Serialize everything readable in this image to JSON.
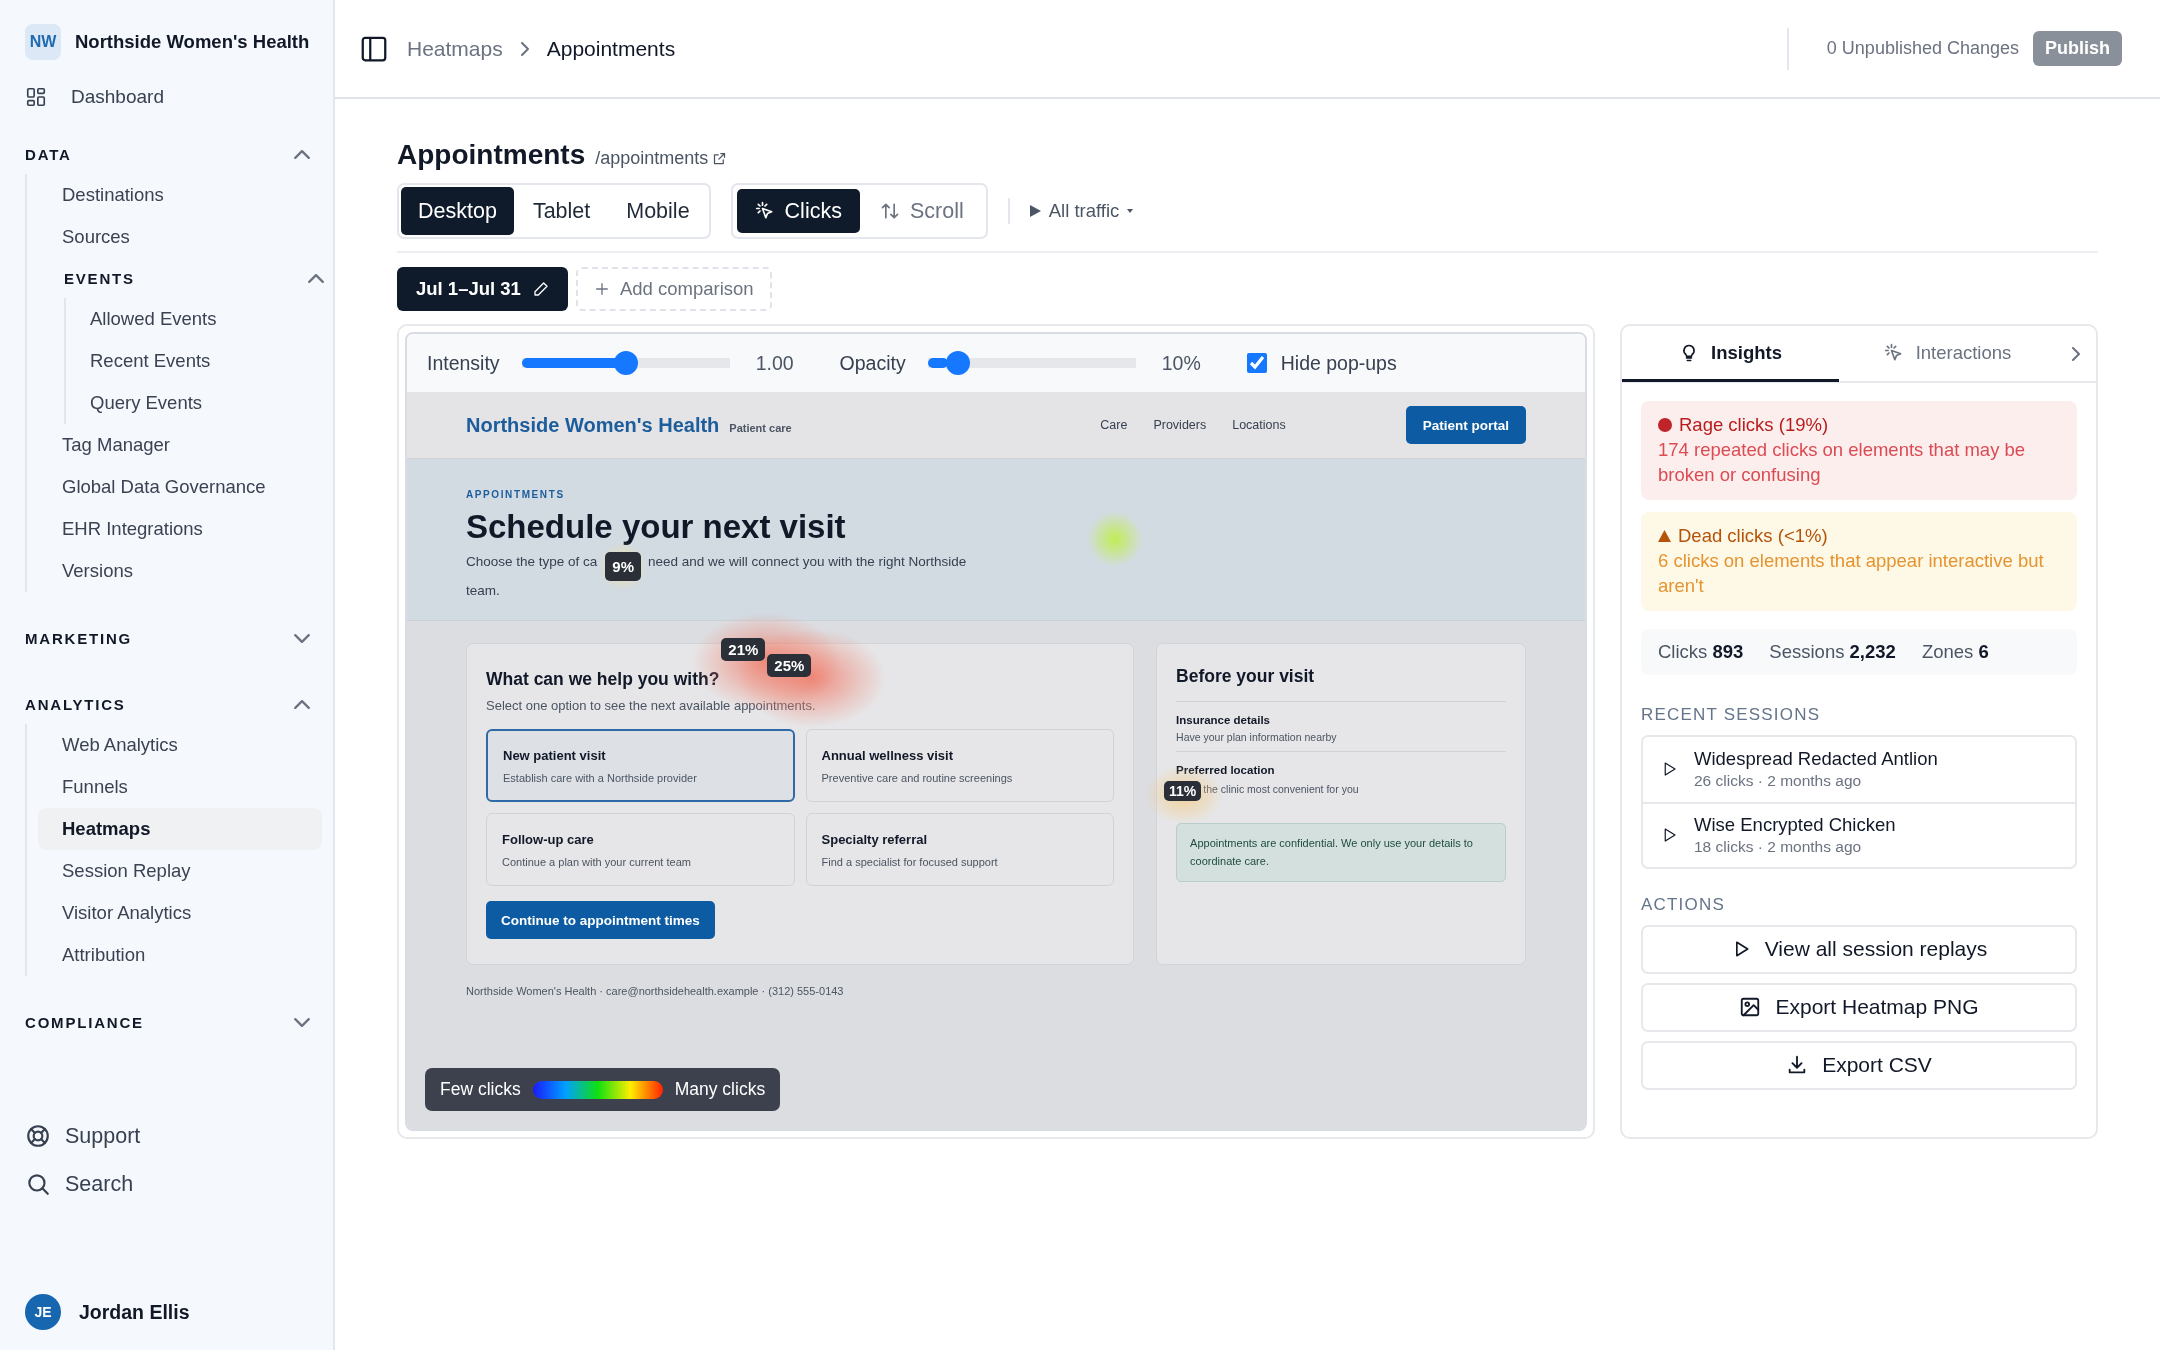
{
  "sidebar": {
    "org": {
      "initials": "NW",
      "name": "Northside Women's Health"
    },
    "dashboard": "Dashboard",
    "sections": [
      {
        "label": "DATA",
        "expanded": true,
        "items": [
          {
            "label": "Destinations",
            "selected": false
          },
          {
            "label": "Sources",
            "selected": false
          },
          {
            "kind": "group",
            "label": "EVENTS",
            "expanded": true,
            "children": [
              {
                "label": "Allowed Events",
                "selected": false
              },
              {
                "label": "Recent Events",
                "selected": false
              },
              {
                "label": "Query Events",
                "selected": false
              }
            ]
          },
          {
            "label": "Tag Manager",
            "selected": false
          },
          {
            "label": "Global Data Governance",
            "selected": false
          },
          {
            "label": "EHR Integrations",
            "selected": false
          },
          {
            "label": "Versions",
            "selected": false
          }
        ]
      },
      {
        "label": "MARKETING",
        "expanded": false
      },
      {
        "label": "ANALYTICS",
        "expanded": true,
        "items": [
          {
            "label": "Web Analytics",
            "selected": false
          },
          {
            "label": "Funnels",
            "selected": false
          },
          {
            "label": "Heatmaps",
            "selected": true
          },
          {
            "label": "Session Replay",
            "selected": false
          },
          {
            "label": "Visitor Analytics",
            "selected": false
          },
          {
            "label": "Attribution",
            "selected": false
          }
        ]
      },
      {
        "label": "COMPLIANCE",
        "expanded": false
      }
    ],
    "footer_links": [
      {
        "kind": "support",
        "label": "Support"
      },
      {
        "kind": "search",
        "label": "Search"
      }
    ],
    "user": {
      "initials": "JE",
      "name": "Jordan Ellis"
    }
  },
  "header": {
    "breadcrumb": [
      "Heatmaps",
      "Appointments"
    ],
    "unpublished": "0 Unpublished Changes",
    "publish": {
      "label": "Publish",
      "disabled": true
    }
  },
  "page": {
    "title": "Appointments",
    "path": "/appointments",
    "devices": [
      {
        "label": "Desktop",
        "selected": true
      },
      {
        "label": "Tablet",
        "selected": false
      },
      {
        "label": "Mobile",
        "selected": false
      }
    ],
    "modes": [
      {
        "kind": "clicks",
        "label": "Clicks",
        "selected": true
      },
      {
        "kind": "scroll",
        "label": "Scroll",
        "selected": false
      }
    ],
    "traffic": "All traffic",
    "date_range": "Jul 1–Jul 31",
    "add_comparison": "Add comparison"
  },
  "controls": {
    "intensity": {
      "label": "Intensity",
      "level": 0.5,
      "reading": "1.00"
    },
    "opacity": {
      "label": "Opacity",
      "level": 0.1,
      "reading": "10%"
    },
    "hide_popups": {
      "label": "Hide pop-ups",
      "checked": true
    }
  },
  "preview": {
    "site_name": "Northside Women's Health",
    "site_tag": "Patient care",
    "nav": [
      "Care",
      "Providers",
      "Locations"
    ],
    "portal": "Patient portal",
    "eyebrow": "APPOINTMENTS",
    "headline": "Schedule your next visit",
    "intro_before": "Choose the type of ca",
    "intro_badge": "9%",
    "intro_after": "need and we will connect you with the right Northside",
    "intro_end": "team.",
    "help": {
      "title": "What can we help you with?",
      "badges": [
        "21%",
        "25%"
      ],
      "subtitle": "Select one option to see the next available appointments.",
      "options": [
        {
          "title": "New patient visit",
          "desc": "Establish care with a Northside provider",
          "selected": true
        },
        {
          "title": "Annual wellness visit",
          "desc": "Preventive care and routine screenings",
          "selected": false
        },
        {
          "title": "Follow-up care",
          "desc": "Continue a plan with your current team",
          "selected": false
        },
        {
          "title": "Specialty referral",
          "desc": "Find a specialist for focused support",
          "selected": false
        }
      ],
      "cta": "Continue to appointment times"
    },
    "before": {
      "title": "Before your visit",
      "items": [
        {
          "title": "Insurance details",
          "desc": "Have your plan information nearby"
        },
        {
          "title": "Preferred location",
          "badge": "11%",
          "desc": "the clinic most convenient for you"
        }
      ],
      "note": "Appointments are confidential. We only use your details to coordinate care."
    },
    "footer": "Northside Women's Health · care@northsidehealth.example · (312) 555-0143",
    "legend": {
      "low": "Few clicks",
      "high": "Many clicks"
    }
  },
  "insights": {
    "tabs": [
      {
        "kind": "insights",
        "label": "Insights",
        "selected": true
      },
      {
        "kind": "interactions",
        "label": "Interactions",
        "selected": false
      }
    ],
    "alerts": [
      {
        "kind": "rage",
        "title": "Rage clicks (19%)",
        "text": "174 repeated clicks on elements that may be broken or confusing"
      },
      {
        "kind": "dead",
        "title": "Dead clicks (<1%)",
        "text": "6 clicks on elements that appear interactive but aren't"
      }
    ],
    "stats": [
      {
        "label": "Clicks",
        "value": "893"
      },
      {
        "label": "Sessions",
        "value": "2,232"
      },
      {
        "label": "Zones",
        "value": "6"
      }
    ],
    "sessions_title": "RECENT SESSIONS",
    "sessions": [
      {
        "name": "Widespread Redacted Antlion",
        "meta": "26 clicks · 2 months ago"
      },
      {
        "name": "Wise Encrypted Chicken",
        "meta": "18 clicks · 2 months ago"
      }
    ],
    "actions_title": "ACTIONS",
    "actions": [
      {
        "kind": "play",
        "label": "View all session replays"
      },
      {
        "kind": "image",
        "label": "Export Heatmap PNG"
      },
      {
        "kind": "download",
        "label": "Export CSV"
      }
    ]
  }
}
